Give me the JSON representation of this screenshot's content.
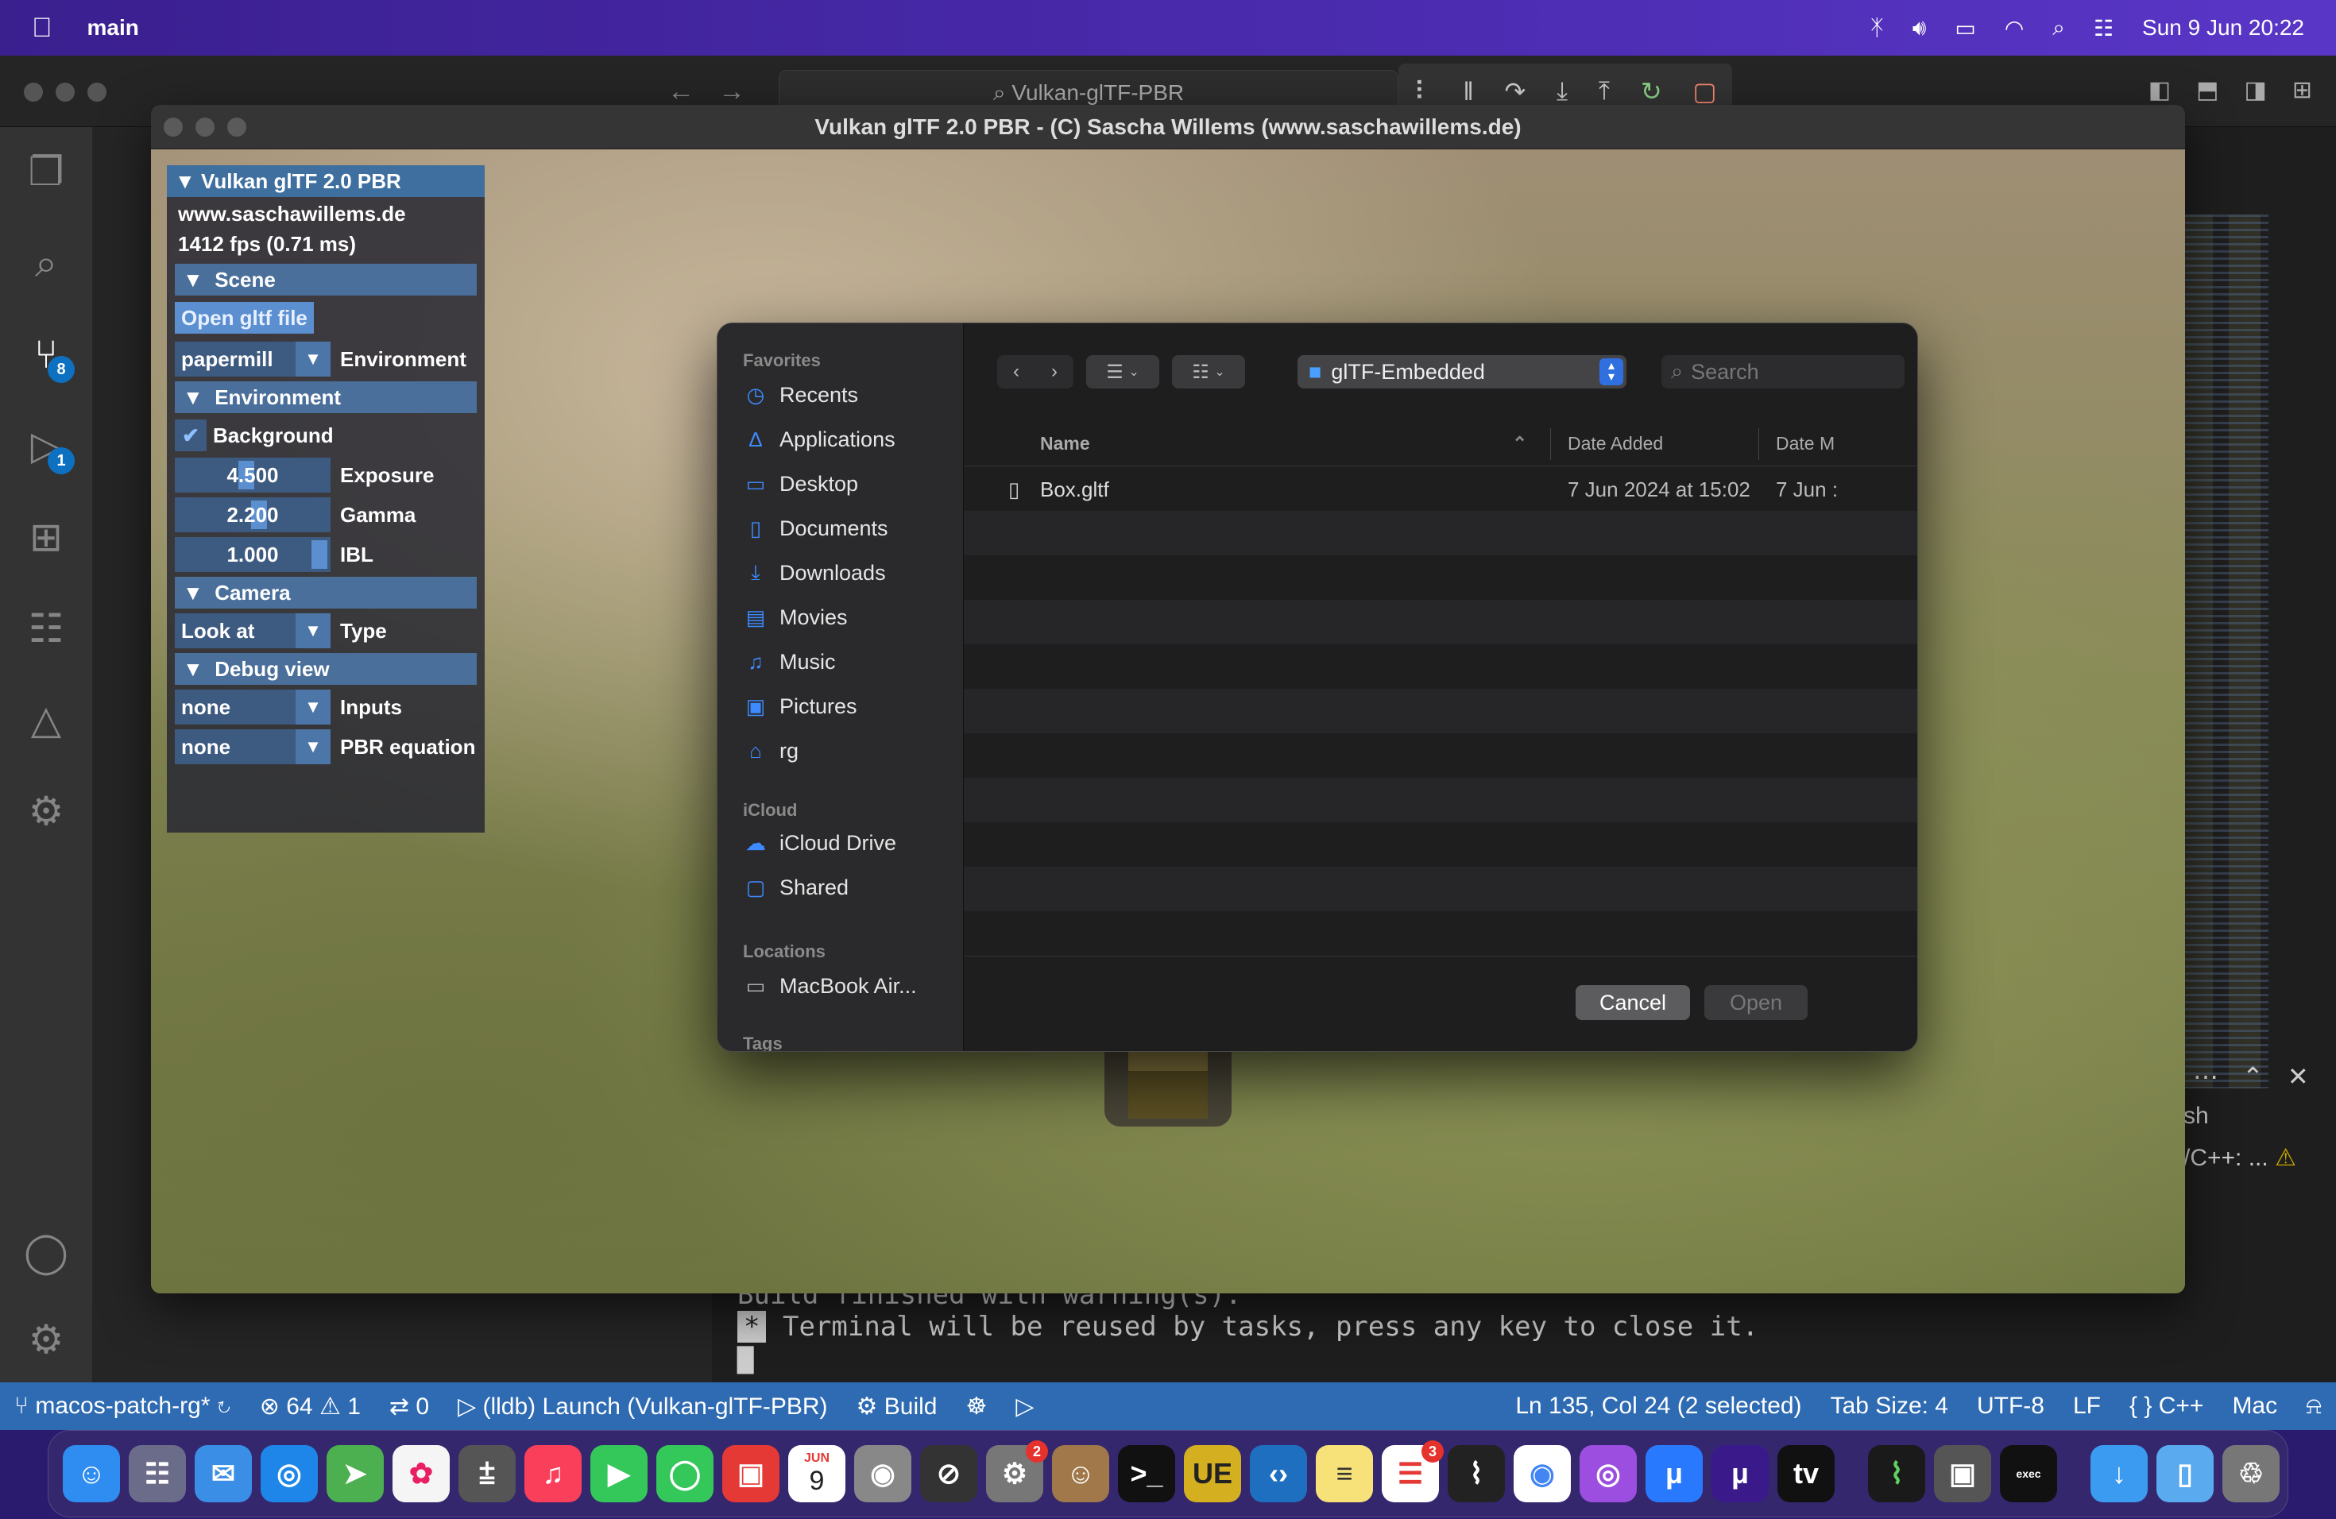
{
  "menubar": {
    "app_name": "main",
    "clock": "Sun 9 Jun  20:22"
  },
  "vscode": {
    "command_center": "Vulkan-glTF-PBR",
    "terminal_lines": [
      "Build finished with warning(s).",
      "Terminal will be reused by tasks, press any key to close it."
    ],
    "terminal_star": "*",
    "terminal_tab": "sh",
    "terminal_warning": "/C++: ...",
    "activity_badges": {
      "source_control": "8",
      "run_debug": "1"
    },
    "status": {
      "branch": "macos-patch-rg*",
      "errors": "64",
      "warnings": "1",
      "ports": "0",
      "launch": "(lldb) Launch (Vulkan-glTF-PBR)",
      "build": "Build",
      "cursor": "Ln 135, Col 24 (2 selected)",
      "tab_size": "Tab Size: 4",
      "encoding": "UTF-8",
      "eol": "LF",
      "language": "C++",
      "platform": "Mac"
    }
  },
  "vulkan": {
    "window_title": "Vulkan glTF 2.0 PBR - (C) Sascha Willems (www.saschawillems.de)",
    "panel": {
      "title": "Vulkan glTF 2.0 PBR",
      "url": "www.saschawillems.de",
      "fps": "1412 fps (0.71 ms)",
      "scene_header": "Scene",
      "open_button": "Open gltf file",
      "environment_value": "papermill",
      "environment_label": "Environment",
      "environment_header": "Environment",
      "background_label": "Background",
      "exposure_value": "4.500",
      "exposure_label": "Exposure",
      "gamma_value": "2.200",
      "gamma_label": "Gamma",
      "ibl_value": "1.000",
      "ibl_label": "IBL",
      "camera_header": "Camera",
      "camera_value": "Look at",
      "camera_label": "Type",
      "debug_header": "Debug view",
      "inputs_value": "none",
      "inputs_label": "Inputs",
      "pbr_value": "none",
      "pbr_label": "PBR equation"
    }
  },
  "dialog": {
    "sidebar": {
      "favorites_label": "Favorites",
      "favorites": [
        {
          "label": "Recents",
          "icon": "clock-icon"
        },
        {
          "label": "Applications",
          "icon": "applications-icon"
        },
        {
          "label": "Desktop",
          "icon": "desktop-icon"
        },
        {
          "label": "Documents",
          "icon": "document-icon"
        },
        {
          "label": "Downloads",
          "icon": "download-icon"
        },
        {
          "label": "Movies",
          "icon": "film-icon"
        },
        {
          "label": "Music",
          "icon": "music-note-icon"
        },
        {
          "label": "Pictures",
          "icon": "photo-icon"
        },
        {
          "label": "rg",
          "icon": "home-icon"
        }
      ],
      "icloud_label": "iCloud",
      "icloud": [
        {
          "label": "iCloud Drive",
          "icon": "cloud-icon"
        },
        {
          "label": "Shared",
          "icon": "shared-folder-icon"
        }
      ],
      "locations_label": "Locations",
      "locations": [
        {
          "label": "MacBook Air...",
          "icon": "laptop-icon"
        }
      ],
      "tags_label": "Tags"
    },
    "path": "glTF-Embedded",
    "search_placeholder": "Search",
    "columns": {
      "name": "Name",
      "date_added": "Date Added",
      "date_modified": "Date M"
    },
    "files": [
      {
        "name": "Box.gltf",
        "date_added": "7 Jun 2024 at 15:02",
        "date_modified": "7 Jun :"
      }
    ],
    "cancel": "Cancel",
    "open": "Open"
  },
  "dock": {
    "calendar_month": "JUN",
    "calendar_day": "9",
    "badges": {
      "system_settings": "2",
      "reminders": "3"
    }
  }
}
